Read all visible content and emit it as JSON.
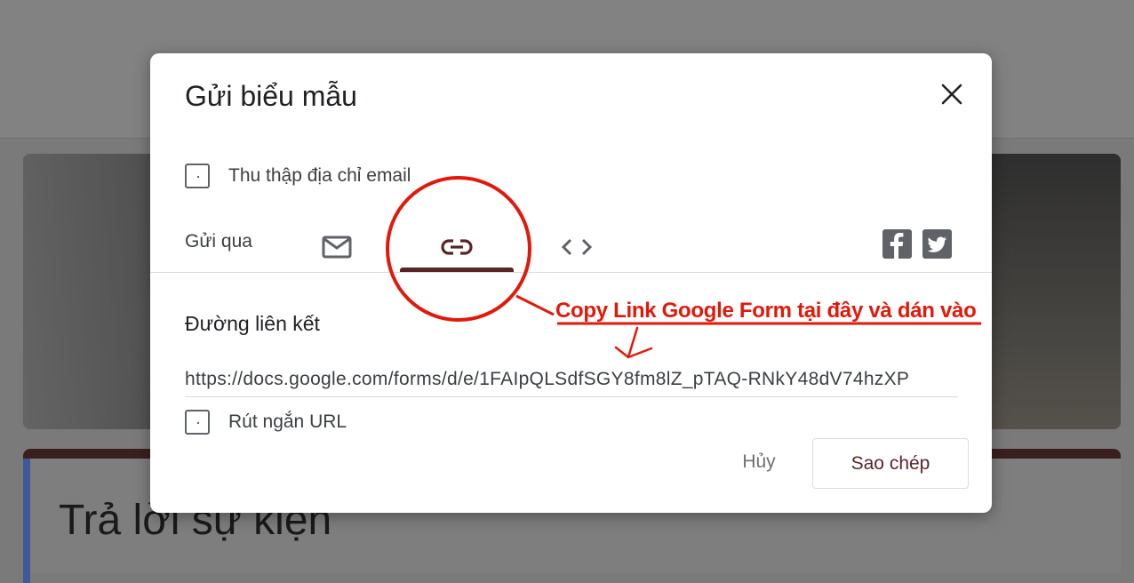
{
  "dialog": {
    "title": "Gửi biểu mẫu",
    "collect_email_label": "Thu thập địa chỉ email",
    "send_via_label": "Gửi qua",
    "tabs": [
      {
        "name": "email",
        "icon": "mail-icon"
      },
      {
        "name": "link",
        "icon": "link-icon",
        "selected": true
      },
      {
        "name": "embed",
        "icon": "embed-code-icon"
      }
    ],
    "social_icons": [
      "facebook-icon",
      "twitter-icon"
    ],
    "link_section_label": "Đường liên kết",
    "link_url": "https://docs.google.com/forms/d/e/1FAIpQLSdfSGY8fm8lZ_pTAQ-RNkY48dV74hzXP",
    "shorten_url_label": "Rút ngắn URL",
    "cancel_label": "Hủy",
    "copy_label": "Sao chép"
  },
  "background": {
    "card_title": "Trả lời sự kiện"
  },
  "annotation": {
    "text": "Copy Link Google Form tại đây và dán vào",
    "color": "#e2190a"
  },
  "colors": {
    "accent": "#5b2424",
    "overlay": "#7a7a7a"
  }
}
